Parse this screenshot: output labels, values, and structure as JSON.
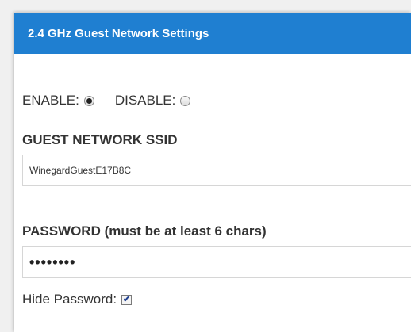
{
  "header": {
    "title": "2.4 GHz Guest Network Settings"
  },
  "enable": {
    "enable_label": "ENABLE:",
    "disable_label": "DISABLE:",
    "selected": "enable"
  },
  "ssid": {
    "label": "GUEST NETWORK SSID",
    "value": "WinegardGuestE17B8C"
  },
  "password": {
    "label": "PASSWORD (must be at least 6 chars)",
    "value": "••••••••"
  },
  "hide_password": {
    "label": "Hide Password:",
    "checked": true,
    "check_glyph": "✔"
  }
}
